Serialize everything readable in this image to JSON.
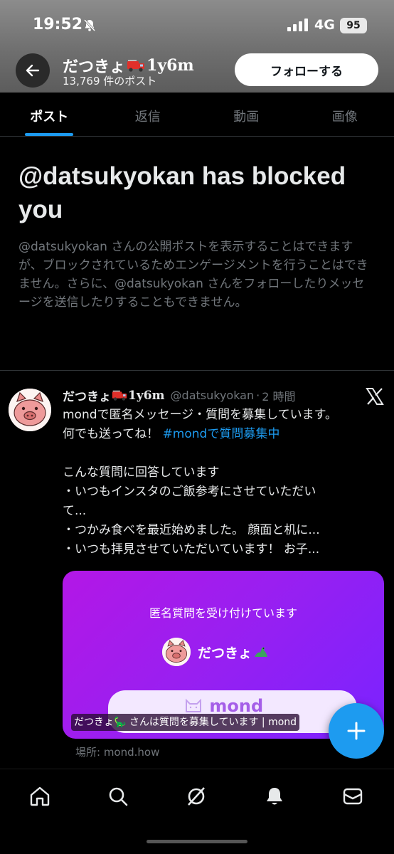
{
  "status_bar": {
    "time": "19:52",
    "network": "4G",
    "battery": "95"
  },
  "header": {
    "profile_name_part1": "だつきょ",
    "profile_name_part2": "1y6m",
    "post_count": "13,769 件のポスト",
    "follow_label": "フォローする"
  },
  "tabs": [
    {
      "label": "ポスト",
      "active": true
    },
    {
      "label": "返信",
      "active": false
    },
    {
      "label": "動画",
      "active": false
    },
    {
      "label": "画像",
      "active": false
    }
  ],
  "blocked": {
    "title": "@datsukyokan has blocked you",
    "body": "@datsukyokan さんの公開ポストを表示することはできますが、ブロックされているためエンゲージメントを行うことはできません。さらに、@datsukyokan さんをフォローしたりメッセージを送信したりすることもできません。"
  },
  "tweet": {
    "name_part1": "だつきょ",
    "name_part2": "1y6m",
    "handle": "@datsukyokan",
    "dot": "·",
    "time": "2 時間",
    "line1": "mondで匿名メッセージ・質問を募集しています。",
    "line2_text": "何でも送ってね！ ",
    "line2_hashtag": "#mondで質問募集中",
    "line3": "こんな質問に回答しています",
    "line4": "・いつもインスタのご飯参考にさせていただい",
    "line5": "て...",
    "line6": "・つかみ食べを最近始めました。 顔面と机に...",
    "line7": "・いつも拝見させていただいています！ お子...",
    "card": {
      "title": "匿名質問を受け付けています",
      "username": "だつきょ",
      "logo": "mond",
      "caption": "だつきょ🦕 さんは質問を募集しています | mond",
      "source": "場所: mond.how"
    }
  },
  "colors": {
    "accent": "#1d9bf0",
    "background": "#000000",
    "muted": "#71767b",
    "card_gradient_start": "#b317e6",
    "card_gradient_end": "#7a23ff"
  },
  "icons": {
    "back": "arrow-left-icon",
    "bell_off": "bell-off-icon",
    "x_logo": "x-logo-icon",
    "compose": "plus-icon",
    "nav": [
      "home-icon",
      "search-icon",
      "grok-icon",
      "bell-icon",
      "mail-icon"
    ]
  }
}
